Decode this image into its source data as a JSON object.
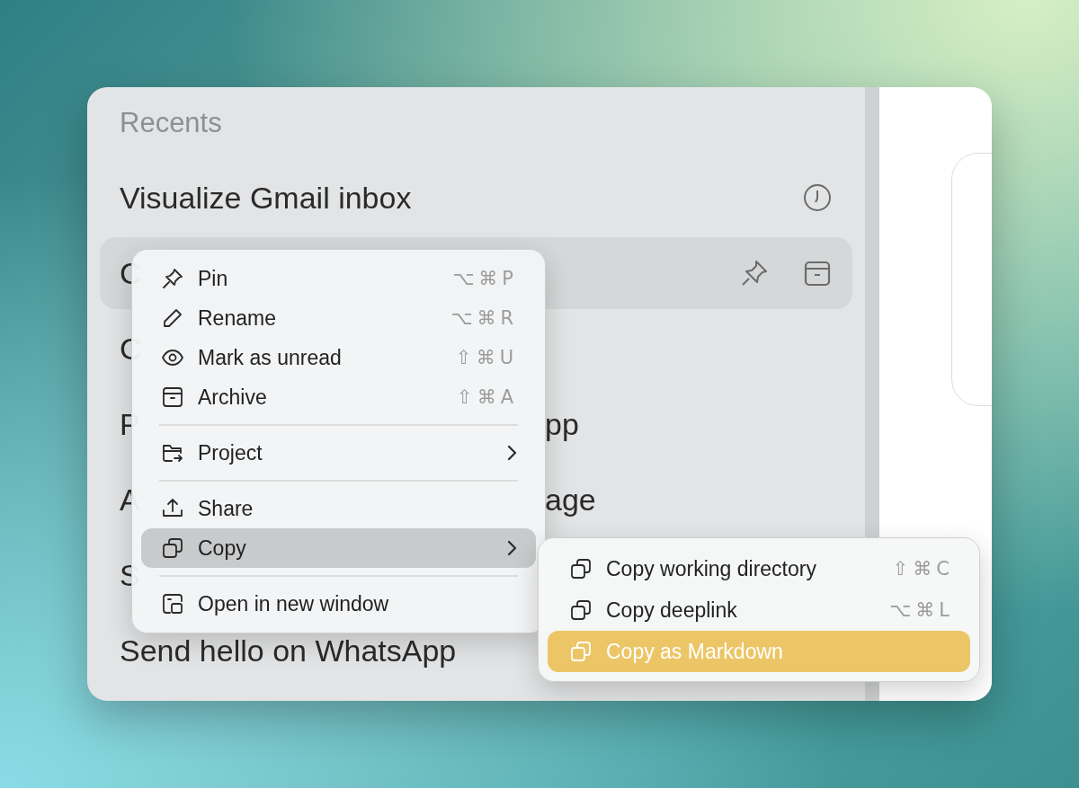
{
  "sidebar": {
    "heading": "Recents",
    "items": [
      {
        "title": "Visualize Gmail inbox",
        "selected": false,
        "kind": "recent"
      },
      {
        "title": "C",
        "selected": true,
        "kind": "hovered"
      },
      {
        "title": "C",
        "selected": false,
        "kind": "plain"
      },
      {
        "title": "P",
        "tail": "pp",
        "selected": false,
        "kind": "plain"
      },
      {
        "title": "A",
        "tail": "age",
        "selected": false,
        "kind": "plain"
      },
      {
        "title": "S",
        "selected": false,
        "kind": "plain"
      },
      {
        "title": "Send hello on WhatsApp",
        "selected": false,
        "kind": "plain"
      }
    ]
  },
  "context_menu": {
    "items": [
      {
        "kind": "item",
        "label": "Pin",
        "shortcut": "⌥⌘P",
        "selected": false
      },
      {
        "kind": "item",
        "label": "Rename",
        "shortcut": "⌥⌘R",
        "selected": false
      },
      {
        "kind": "item",
        "label": "Mark as unread",
        "shortcut": "⇧⌘U",
        "selected": false
      },
      {
        "kind": "item",
        "label": "Archive",
        "shortcut": "⇧⌘A",
        "selected": false
      },
      {
        "kind": "separator"
      },
      {
        "kind": "submenu",
        "label": "Project",
        "selected": false
      },
      {
        "kind": "separator"
      },
      {
        "kind": "item",
        "label": "Share",
        "selected": false
      },
      {
        "kind": "submenu",
        "label": "Copy",
        "selected": true
      },
      {
        "kind": "separator"
      },
      {
        "kind": "item",
        "label": "Open in new window",
        "selected": false
      }
    ]
  },
  "submenu": {
    "items": [
      {
        "label": "Copy working directory",
        "shortcut": "⇧⌘C",
        "selected": false
      },
      {
        "label": "Copy deeplink",
        "shortcut": "⌥⌘L",
        "selected": false
      },
      {
        "label": "Copy as Markdown",
        "selected": true
      }
    ]
  }
}
